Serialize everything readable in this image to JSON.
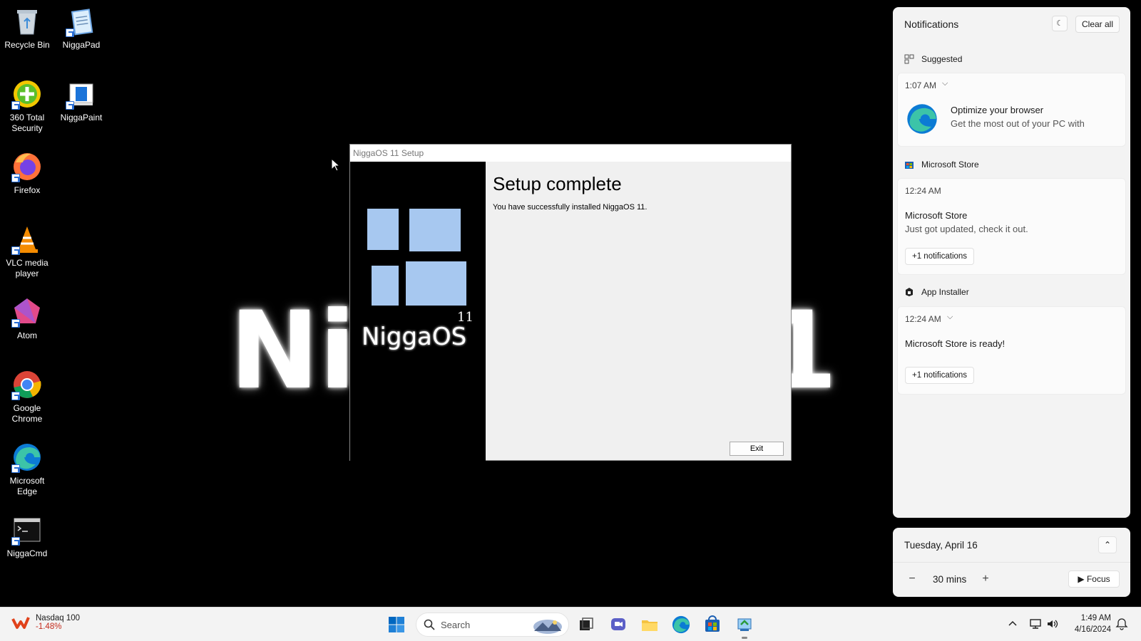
{
  "desktop": {
    "wallpaper": {
      "left_text": "Ni",
      "right_text": "1"
    },
    "icons": [
      {
        "label": "Recycle Bin",
        "icon": "recycle-bin-icon"
      },
      {
        "label": "NiggaPad",
        "icon": "notepad-icon"
      },
      {
        "label": "360 Total Security",
        "icon": "security-icon"
      },
      {
        "label": "NiggaPaint",
        "icon": "paint-icon"
      },
      {
        "label": "Firefox",
        "icon": "firefox-icon"
      },
      {
        "label": "VLC media player",
        "icon": "vlc-icon"
      },
      {
        "label": "Atom",
        "icon": "atom-icon"
      },
      {
        "label": "Google Chrome",
        "icon": "chrome-icon"
      },
      {
        "label": "Microsoft Edge",
        "icon": "edge-icon"
      },
      {
        "label": "NiggaCmd",
        "icon": "cmd-icon"
      }
    ]
  },
  "setup": {
    "title": "NiggaOS 11 Setup",
    "logo_text": "NiggaOS",
    "logo_version": "11",
    "heading": "Setup complete",
    "description": "You have successfully installed NiggaOS 11.",
    "exit_label": "Exit",
    "tile_color": "#a7c8f0"
  },
  "notifications": {
    "header": "Notifications",
    "clear_all": "Clear all",
    "groups": [
      {
        "name": "Suggested",
        "time": "1:07 AM",
        "title": "Optimize your browser",
        "body": "Get the most out of your PC with"
      },
      {
        "name": "Microsoft Store",
        "time": "12:24 AM",
        "title": "Microsoft Store",
        "body": "Just got updated, check it out.",
        "more": "+1 notifications"
      },
      {
        "name": "App Installer",
        "time": "12:24 AM",
        "title": "Microsoft Store is ready!",
        "more": "+1 notifications"
      }
    ]
  },
  "calendar": {
    "date": "Tuesday, April 16",
    "focus_minutes": "30 mins",
    "focus_label": "Focus"
  },
  "taskbar": {
    "widget_name": "Nasdaq 100",
    "widget_value": "-1.48%",
    "search_label": "Search",
    "time": "1:49 AM",
    "date": "4/16/2024",
    "accent": "#0067c0"
  }
}
